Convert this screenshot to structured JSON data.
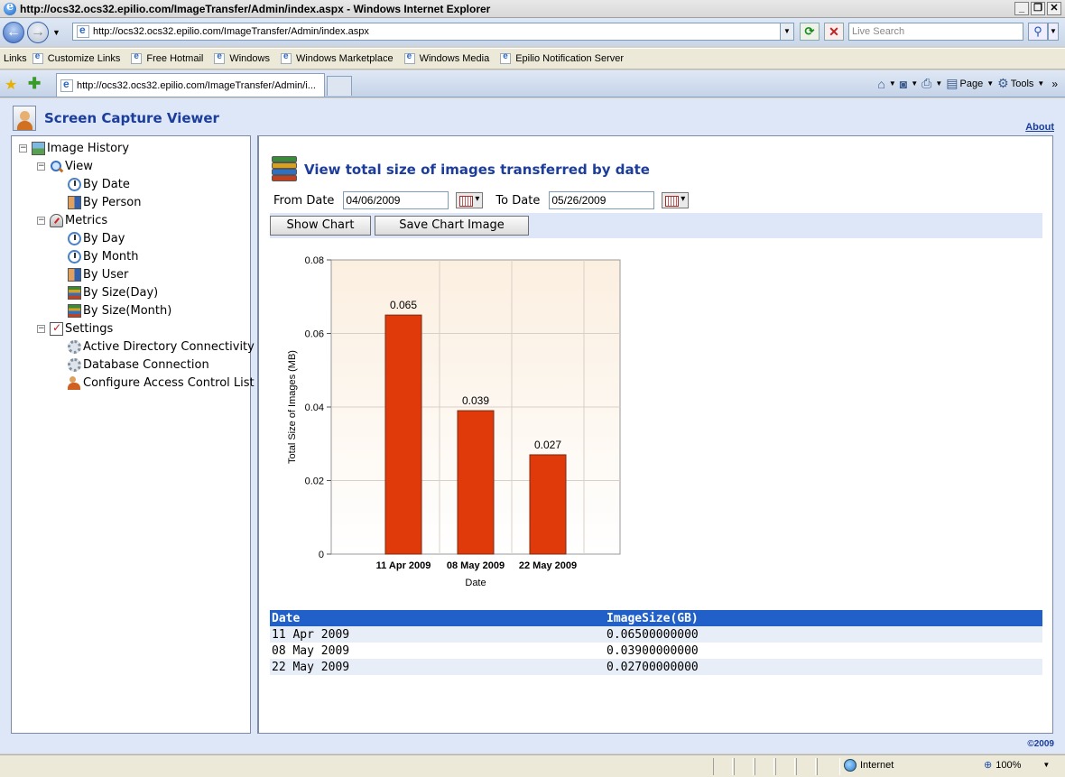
{
  "window": {
    "title": "http://ocs32.ocs32.epilio.com/ImageTransfer/Admin/index.aspx - Windows Internet Explorer",
    "buttons": [
      "_",
      "❐",
      "✕"
    ]
  },
  "addressbar": {
    "url": "http://ocs32.ocs32.epilio.com/ImageTransfer/Admin/index.aspx",
    "search_placeholder": "Live Search"
  },
  "links": {
    "label": "Links",
    "items": [
      "Customize Links",
      "Free Hotmail",
      "Windows",
      "Windows Marketplace",
      "Windows Media",
      "Epilio Notification Server"
    ]
  },
  "tabs": {
    "active_tab": "http://ocs32.ocs32.epilio.com/ImageTransfer/Admin/i...",
    "page_menu": "Page",
    "tools_menu": "Tools"
  },
  "app": {
    "title": "Screen Capture Viewer",
    "about": "About",
    "copyright": "©2009"
  },
  "tree": {
    "root": "Image History",
    "view": "View",
    "by_date": "By Date",
    "by_person": "By Person",
    "metrics": "Metrics",
    "by_day": "By Day",
    "by_month": "By Month",
    "by_user": "By User",
    "by_size_day": "By Size(Day)",
    "by_size_month": "By Size(Month)",
    "settings": "Settings",
    "active_directory": "Active Directory Connectivity",
    "database": "Database Connection",
    "acl": "Configure Access Control List"
  },
  "main": {
    "title": "View total size of images transferred by date",
    "from_label": "From Date",
    "from_value": "04/06/2009",
    "to_label": "To Date",
    "to_value": "05/26/2009",
    "show_chart": "Show Chart",
    "save_chart": "Save Chart Image"
  },
  "chart_data": {
    "type": "bar",
    "categories": [
      "11 Apr 2009",
      "08 May 2009",
      "22 May 2009"
    ],
    "values": [
      0.065,
      0.039,
      0.027
    ],
    "value_labels": [
      "0.065",
      "0.039",
      "0.027"
    ],
    "xlabel": "Date",
    "ylabel": "Total Size of Images (MB)",
    "ylim": [
      0,
      0.08
    ],
    "yticks": [
      0,
      0.02,
      0.04,
      0.06,
      0.08
    ],
    "ytick_labels": [
      "0",
      "0.02",
      "0.04",
      "0.06",
      "0.08"
    ],
    "grid": true,
    "bar_color": "#e03a0a"
  },
  "table": {
    "headers": [
      "Date",
      "ImageSize(GB)"
    ],
    "rows": [
      [
        "11 Apr 2009",
        "0.06500000000"
      ],
      [
        "08 May 2009",
        "0.03900000000"
      ],
      [
        "22 May 2009",
        "0.02700000000"
      ]
    ]
  },
  "status": {
    "zone": "Internet",
    "zoom": "100%"
  }
}
